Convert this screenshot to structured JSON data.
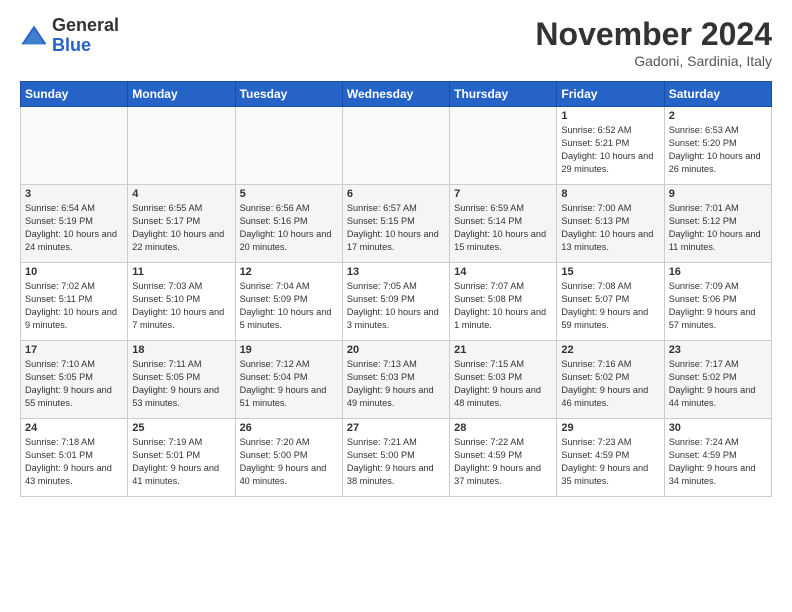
{
  "header": {
    "logo_line1": "General",
    "logo_line2": "Blue",
    "month": "November 2024",
    "location": "Gadoni, Sardinia, Italy"
  },
  "weekdays": [
    "Sunday",
    "Monday",
    "Tuesday",
    "Wednesday",
    "Thursday",
    "Friday",
    "Saturday"
  ],
  "weeks": [
    [
      {
        "day": "",
        "info": "",
        "empty": true
      },
      {
        "day": "",
        "info": "",
        "empty": true
      },
      {
        "day": "",
        "info": "",
        "empty": true
      },
      {
        "day": "",
        "info": "",
        "empty": true
      },
      {
        "day": "",
        "info": "",
        "empty": true
      },
      {
        "day": "1",
        "info": "Sunrise: 6:52 AM\nSunset: 5:21 PM\nDaylight: 10 hours and 29 minutes."
      },
      {
        "day": "2",
        "info": "Sunrise: 6:53 AM\nSunset: 5:20 PM\nDaylight: 10 hours and 26 minutes."
      }
    ],
    [
      {
        "day": "3",
        "info": "Sunrise: 6:54 AM\nSunset: 5:19 PM\nDaylight: 10 hours and 24 minutes."
      },
      {
        "day": "4",
        "info": "Sunrise: 6:55 AM\nSunset: 5:17 PM\nDaylight: 10 hours and 22 minutes."
      },
      {
        "day": "5",
        "info": "Sunrise: 6:56 AM\nSunset: 5:16 PM\nDaylight: 10 hours and 20 minutes."
      },
      {
        "day": "6",
        "info": "Sunrise: 6:57 AM\nSunset: 5:15 PM\nDaylight: 10 hours and 17 minutes."
      },
      {
        "day": "7",
        "info": "Sunrise: 6:59 AM\nSunset: 5:14 PM\nDaylight: 10 hours and 15 minutes."
      },
      {
        "day": "8",
        "info": "Sunrise: 7:00 AM\nSunset: 5:13 PM\nDaylight: 10 hours and 13 minutes."
      },
      {
        "day": "9",
        "info": "Sunrise: 7:01 AM\nSunset: 5:12 PM\nDaylight: 10 hours and 11 minutes."
      }
    ],
    [
      {
        "day": "10",
        "info": "Sunrise: 7:02 AM\nSunset: 5:11 PM\nDaylight: 10 hours and 9 minutes."
      },
      {
        "day": "11",
        "info": "Sunrise: 7:03 AM\nSunset: 5:10 PM\nDaylight: 10 hours and 7 minutes."
      },
      {
        "day": "12",
        "info": "Sunrise: 7:04 AM\nSunset: 5:09 PM\nDaylight: 10 hours and 5 minutes."
      },
      {
        "day": "13",
        "info": "Sunrise: 7:05 AM\nSunset: 5:09 PM\nDaylight: 10 hours and 3 minutes."
      },
      {
        "day": "14",
        "info": "Sunrise: 7:07 AM\nSunset: 5:08 PM\nDaylight: 10 hours and 1 minute."
      },
      {
        "day": "15",
        "info": "Sunrise: 7:08 AM\nSunset: 5:07 PM\nDaylight: 9 hours and 59 minutes."
      },
      {
        "day": "16",
        "info": "Sunrise: 7:09 AM\nSunset: 5:06 PM\nDaylight: 9 hours and 57 minutes."
      }
    ],
    [
      {
        "day": "17",
        "info": "Sunrise: 7:10 AM\nSunset: 5:05 PM\nDaylight: 9 hours and 55 minutes."
      },
      {
        "day": "18",
        "info": "Sunrise: 7:11 AM\nSunset: 5:05 PM\nDaylight: 9 hours and 53 minutes."
      },
      {
        "day": "19",
        "info": "Sunrise: 7:12 AM\nSunset: 5:04 PM\nDaylight: 9 hours and 51 minutes."
      },
      {
        "day": "20",
        "info": "Sunrise: 7:13 AM\nSunset: 5:03 PM\nDaylight: 9 hours and 49 minutes."
      },
      {
        "day": "21",
        "info": "Sunrise: 7:15 AM\nSunset: 5:03 PM\nDaylight: 9 hours and 48 minutes."
      },
      {
        "day": "22",
        "info": "Sunrise: 7:16 AM\nSunset: 5:02 PM\nDaylight: 9 hours and 46 minutes."
      },
      {
        "day": "23",
        "info": "Sunrise: 7:17 AM\nSunset: 5:02 PM\nDaylight: 9 hours and 44 minutes."
      }
    ],
    [
      {
        "day": "24",
        "info": "Sunrise: 7:18 AM\nSunset: 5:01 PM\nDaylight: 9 hours and 43 minutes."
      },
      {
        "day": "25",
        "info": "Sunrise: 7:19 AM\nSunset: 5:01 PM\nDaylight: 9 hours and 41 minutes."
      },
      {
        "day": "26",
        "info": "Sunrise: 7:20 AM\nSunset: 5:00 PM\nDaylight: 9 hours and 40 minutes."
      },
      {
        "day": "27",
        "info": "Sunrise: 7:21 AM\nSunset: 5:00 PM\nDaylight: 9 hours and 38 minutes."
      },
      {
        "day": "28",
        "info": "Sunrise: 7:22 AM\nSunset: 4:59 PM\nDaylight: 9 hours and 37 minutes."
      },
      {
        "day": "29",
        "info": "Sunrise: 7:23 AM\nSunset: 4:59 PM\nDaylight: 9 hours and 35 minutes."
      },
      {
        "day": "30",
        "info": "Sunrise: 7:24 AM\nSunset: 4:59 PM\nDaylight: 9 hours and 34 minutes."
      }
    ]
  ]
}
